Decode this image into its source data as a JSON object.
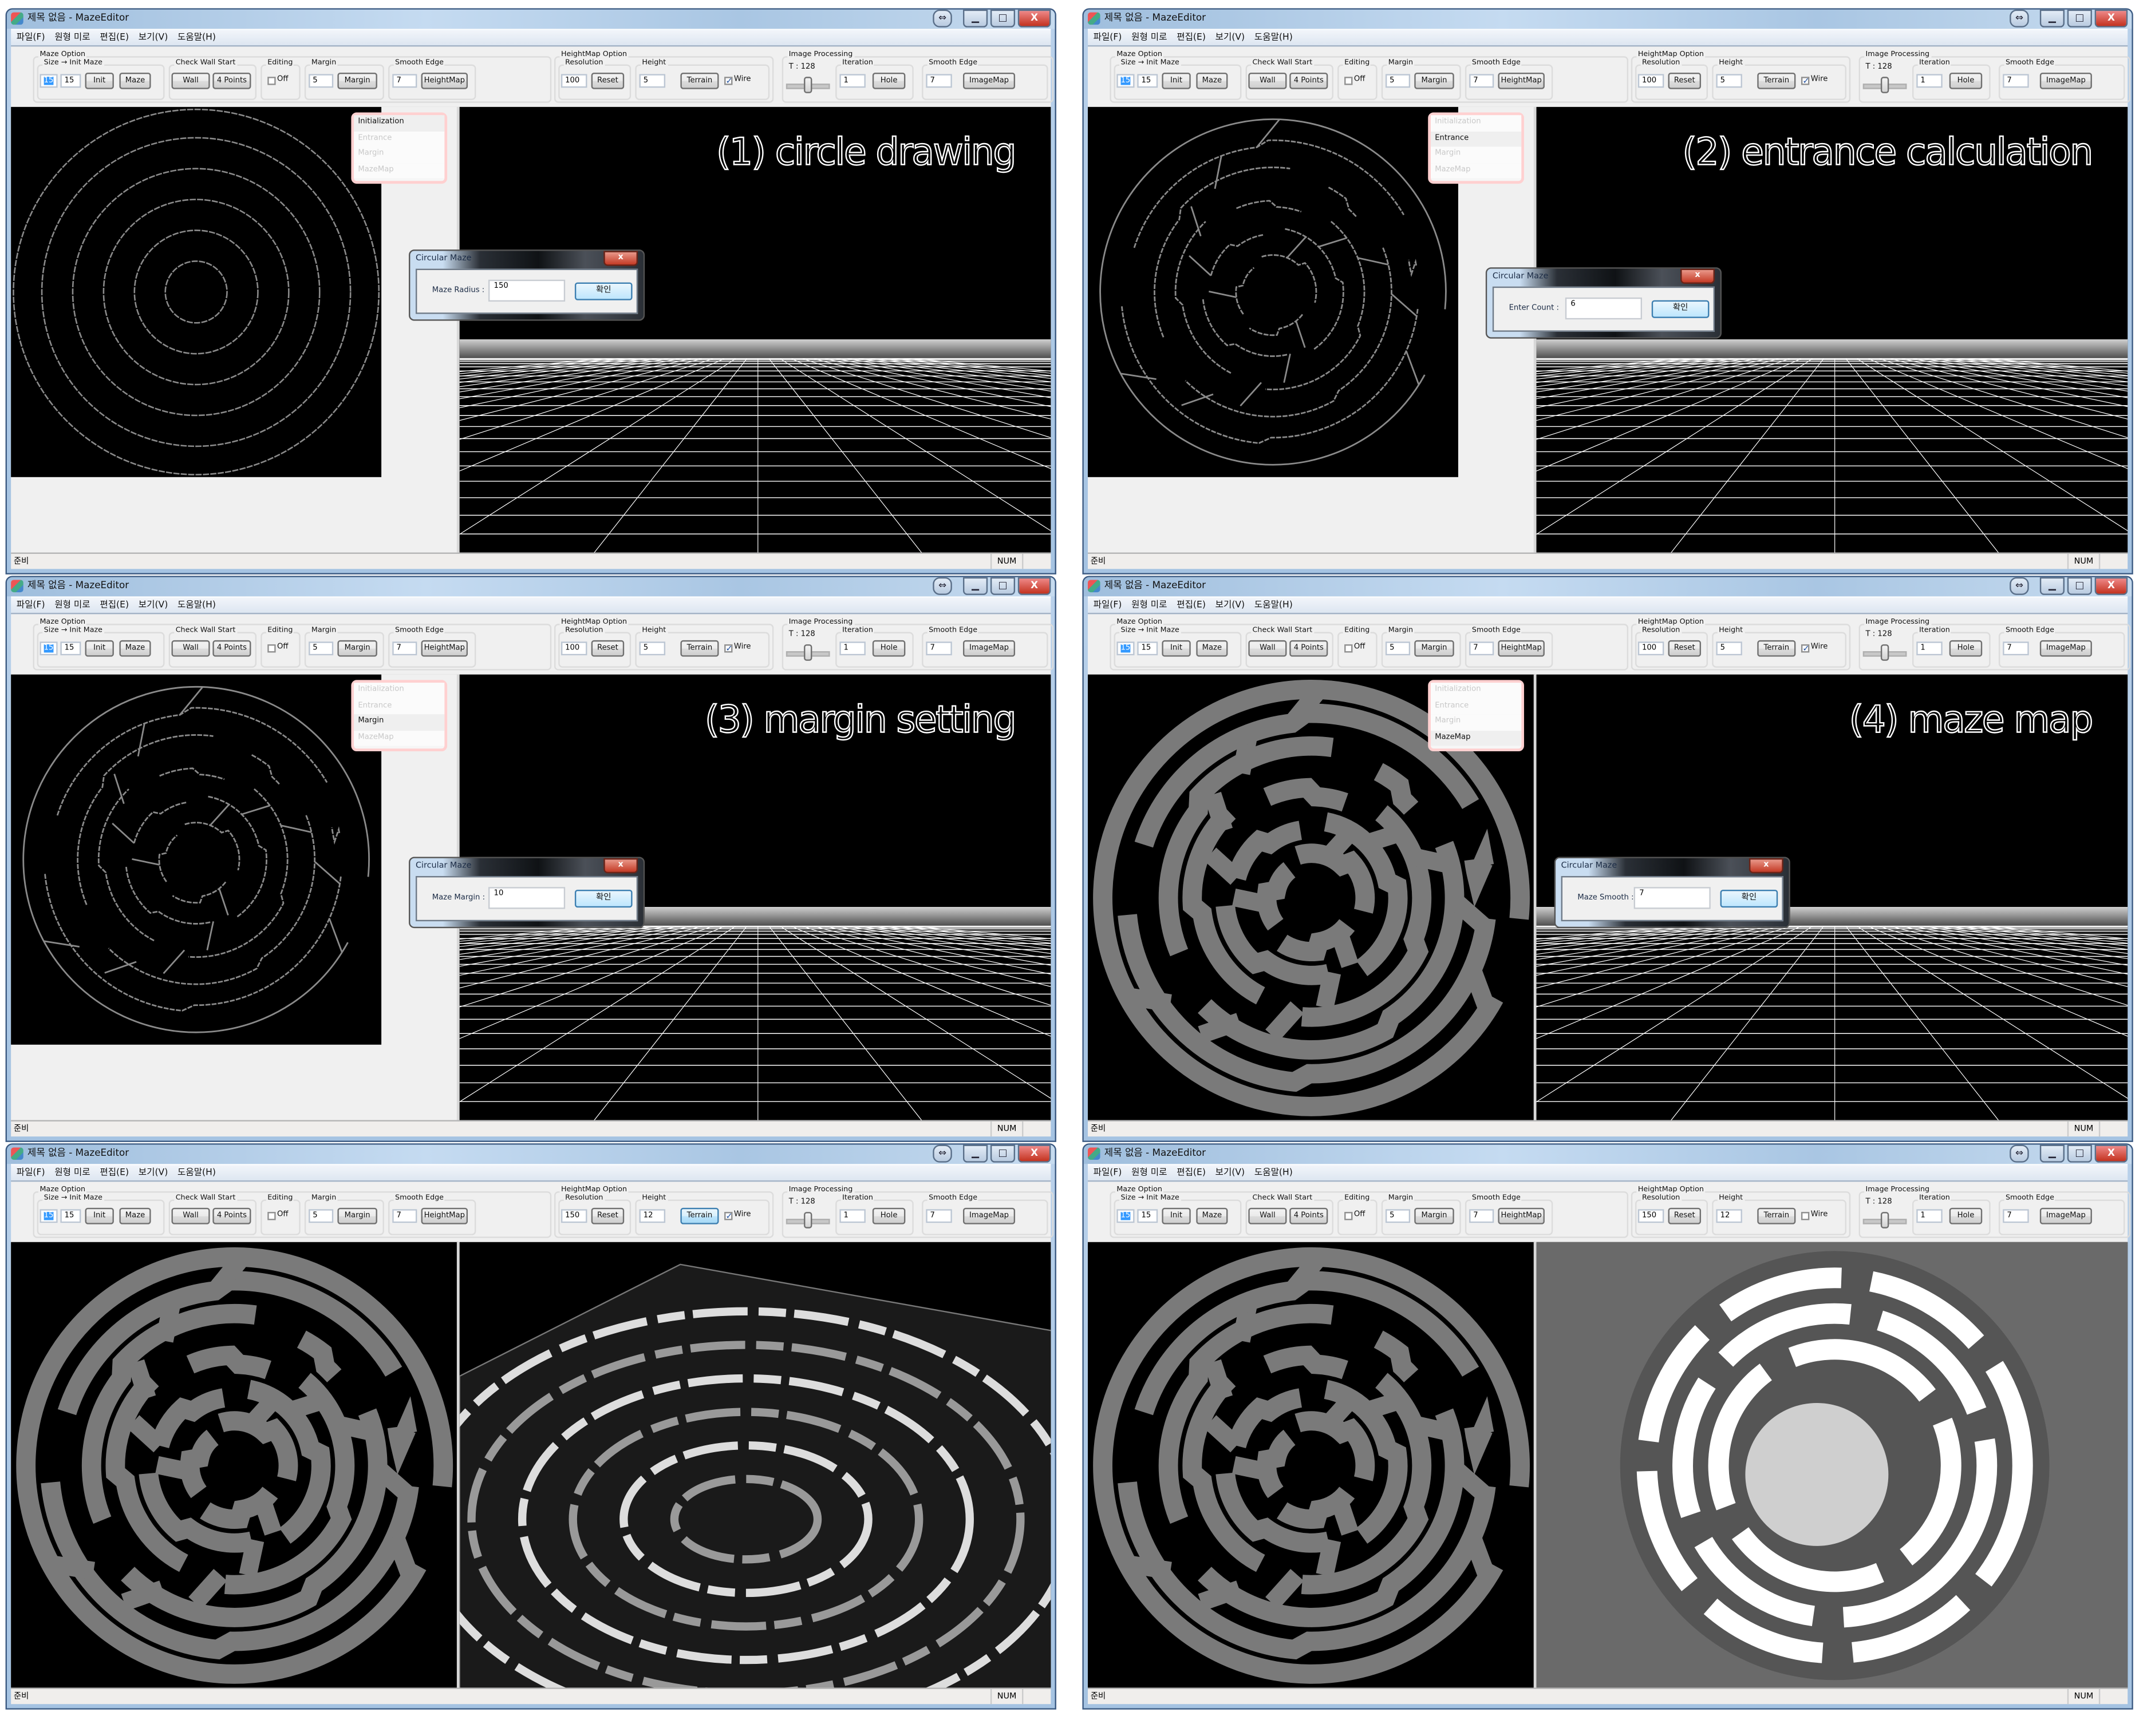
{
  "app": {
    "title": "제목 없음 - MazeEditor",
    "menu": [
      "파일(F)",
      "원형 미로",
      "편집(E)",
      "보기(V)",
      "도움말(H)"
    ],
    "status_left": "준비",
    "status_num": "NUM",
    "window_buttons": {
      "restore": "⇔",
      "minimize": "▁",
      "maximize": "□",
      "close": "X"
    }
  },
  "toolbar_labels": {
    "maze_option": "Maze Option",
    "size_init_maze": "Size → Init Maze",
    "init": "Init",
    "maze": "Maze",
    "check_wall_start": "Check Wall  Start",
    "wall": "Wall",
    "four_points": "4 Points",
    "editing": "Editing",
    "off": "Off",
    "margin_group": "Margin",
    "margin_button": "Margin",
    "smooth_edge": "Smooth Edge",
    "heightmap_button": "HeightMap",
    "heightmap_option": "HeightMap Option",
    "resolution": "Resolution",
    "reset": "Reset",
    "height": "Height",
    "terrain": "Terrain",
    "wire": "Wire",
    "image_processing": "Image Processing",
    "threshold": "T : 128",
    "iteration": "Iteration",
    "hole": "Hole",
    "smooth_edge_ip": "Smooth Edge",
    "imagemap": "ImageMap"
  },
  "steps": [
    "Initialization",
    "Entrance",
    "Margin",
    "MazeMap"
  ],
  "dialog_title": "Circular Maze",
  "dialog_ok": "확인",
  "panels": [
    {
      "caption": "(1) circle drawing",
      "active_step": 0,
      "values": {
        "size1": "15",
        "size2": "15",
        "margin": "5",
        "smooth": "7",
        "resolution": "100",
        "height": "5",
        "wire": true,
        "threshold_slider": 0.5,
        "iteration": "1",
        "smooth_ip": "7"
      },
      "dialog": {
        "label": "Maze Radius :",
        "value": "150"
      }
    },
    {
      "caption": "(2) entrance calculation",
      "active_step": 1,
      "values": {
        "size1": "15",
        "size2": "15",
        "margin": "5",
        "smooth": "7",
        "resolution": "100",
        "height": "5",
        "wire": true,
        "threshold_slider": 0.5,
        "iteration": "1",
        "smooth_ip": "7"
      },
      "dialog": {
        "label": "Enter Count :",
        "value": "6"
      }
    },
    {
      "caption": "(3) margin setting",
      "active_step": 2,
      "values": {
        "size1": "15",
        "size2": "15",
        "margin": "5",
        "smooth": "7",
        "resolution": "100",
        "height": "5",
        "wire": true,
        "threshold_slider": 0.5,
        "iteration": "1",
        "smooth_ip": "7"
      },
      "dialog": {
        "label": "Maze Margin :",
        "value": "10"
      }
    },
    {
      "caption": "(4) maze map",
      "active_step": 3,
      "values": {
        "size1": "15",
        "size2": "15",
        "margin": "5",
        "smooth": "7",
        "resolution": "100",
        "height": "5",
        "wire": true,
        "threshold_slider": 0.5,
        "iteration": "1",
        "smooth_ip": "7"
      },
      "dialog": {
        "label": "Maze Smooth :",
        "value": "7"
      }
    },
    {
      "caption": "",
      "values": {
        "size1": "15",
        "size2": "15",
        "margin": "5",
        "smooth": "7",
        "resolution": "150",
        "height": "12",
        "wire": true,
        "threshold_slider": 0.5,
        "iteration": "1",
        "smooth_ip": "7"
      }
    },
    {
      "caption": "",
      "values": {
        "size1": "15",
        "size2": "15",
        "margin": "5",
        "smooth": "7",
        "resolution": "150",
        "height": "12",
        "wire": false,
        "threshold_slider": 0.5,
        "iteration": "1",
        "smooth_ip": "7"
      }
    }
  ],
  "colors": {
    "canvas_bg": "#000000",
    "maze_path": "#7a7a7a",
    "window_frame": "#a9c6e3",
    "step_border": "#ffd0d0"
  }
}
